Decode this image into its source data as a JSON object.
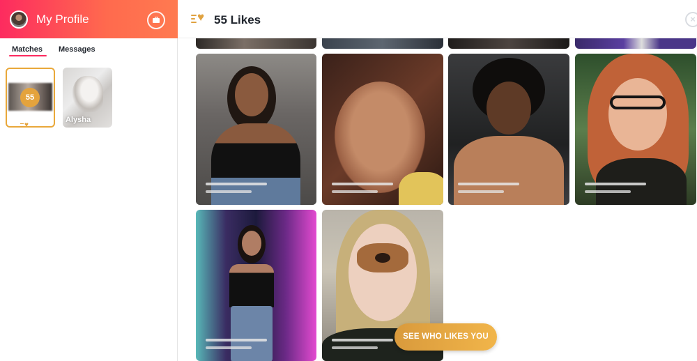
{
  "sidebar": {
    "profile_title": "My Profile",
    "tabs": [
      {
        "label": "Matches",
        "active": true
      },
      {
        "label": "Messages",
        "active": false
      }
    ],
    "likes_card": {
      "count": "55"
    },
    "matches": [
      {
        "name": "Alysha"
      }
    ]
  },
  "main": {
    "title": "55 Likes",
    "see_who_button": "SEE WHO LIKES YOU"
  },
  "colors": {
    "brand_gradient_start": "#fd2b5f",
    "brand_gradient_end": "#ff7a50",
    "gold": "#e4a33d"
  },
  "icons": {
    "avatar": "avatar",
    "briefcase": "briefcase-icon",
    "likes": "gold-heart-icon",
    "close": "close-icon"
  }
}
